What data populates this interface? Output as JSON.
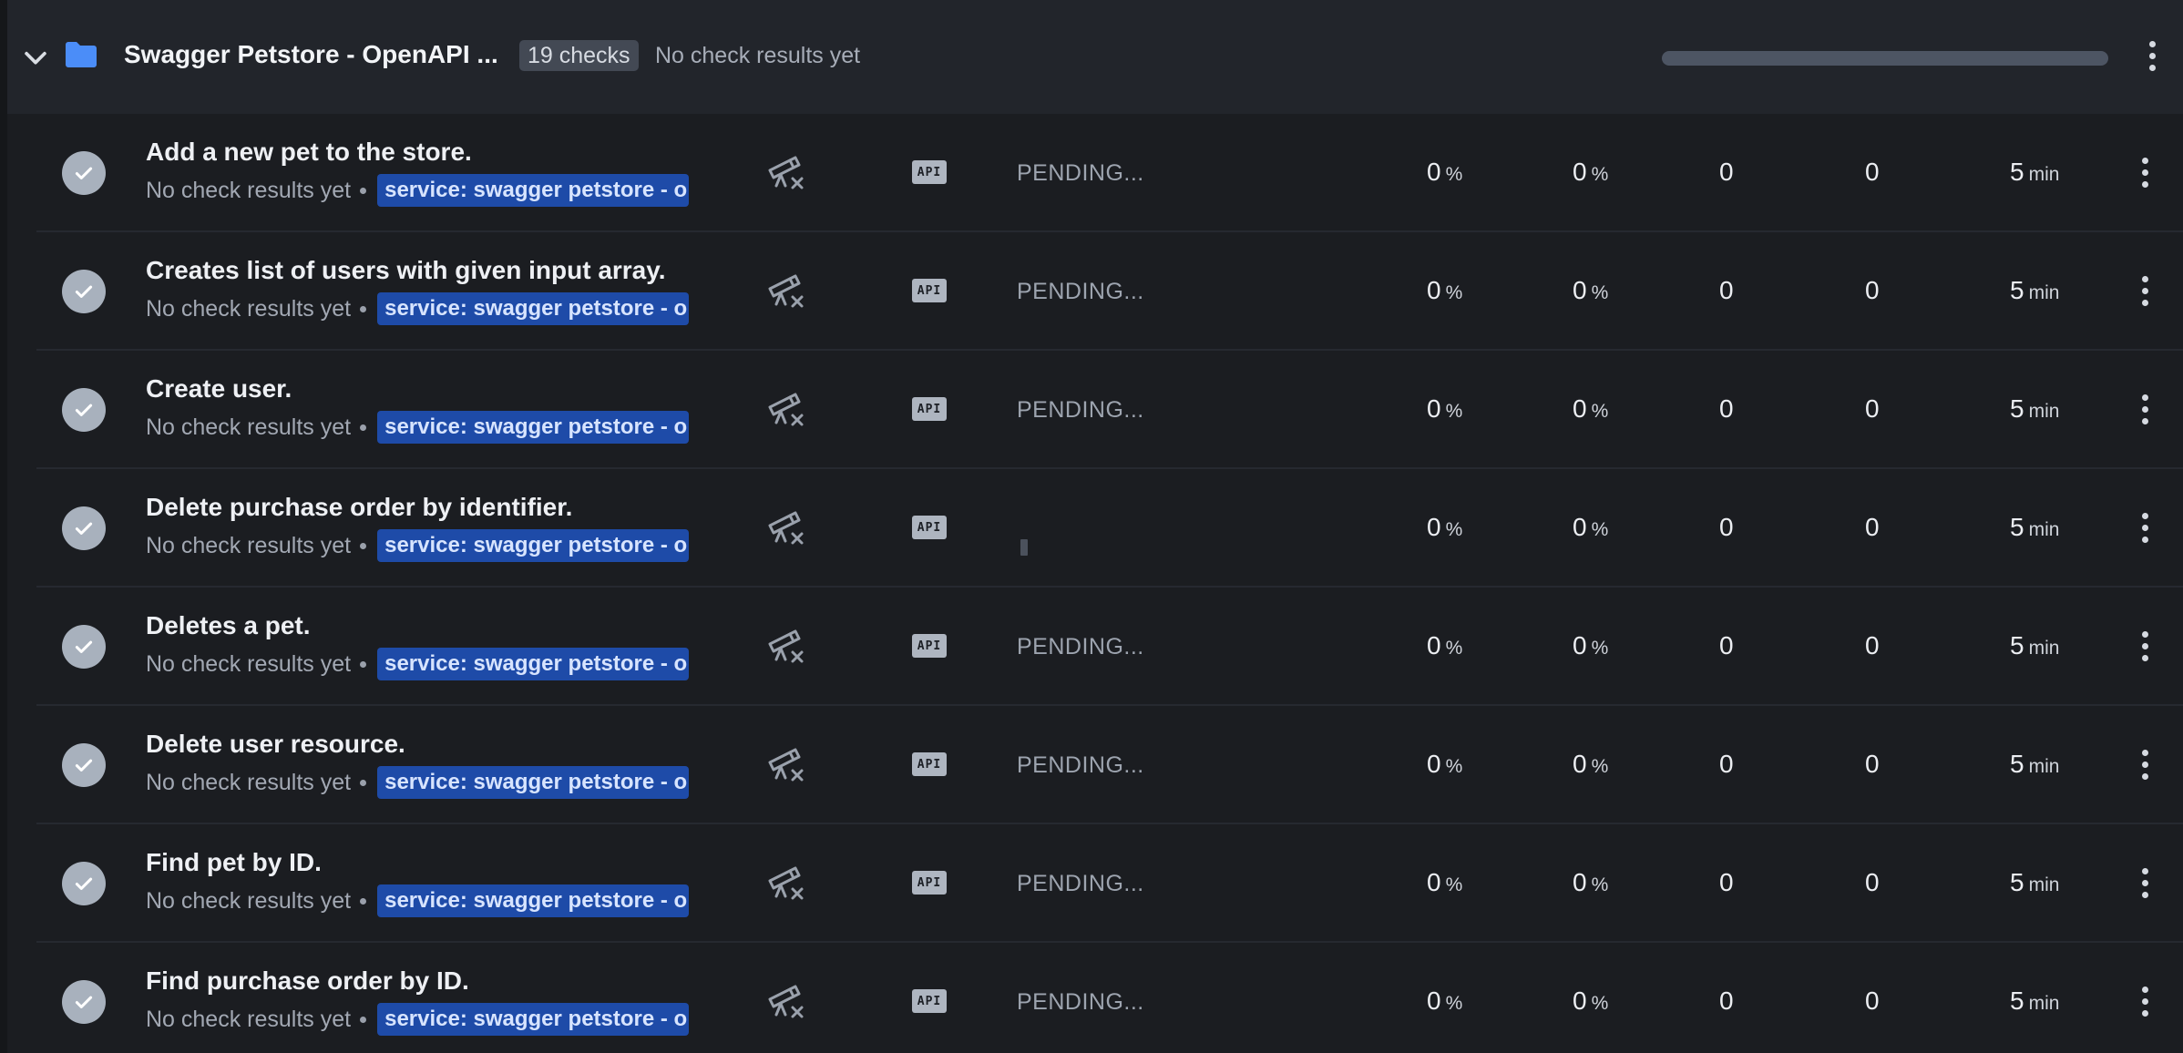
{
  "group": {
    "title": "Swagger Petstore - OpenAPI ...",
    "count_badge": "19 checks",
    "status": "No check results yet",
    "progress": 0,
    "icons": {
      "toggle": "chevron-down-icon",
      "folder": "folder-icon",
      "menu": "more-vertical-icon"
    }
  },
  "colors": {
    "accent_blue": "#1e4ba8",
    "folder_blue": "#4b8df8",
    "tag_text": "#d7e4ff"
  },
  "checks": [
    {
      "title": "Add a new pet to the store.",
      "subtitle": "No check results yet",
      "tag": "service: swagger petstore - o",
      "type": "API",
      "state": "PENDING...",
      "success_24h": "0",
      "success_7d": "0",
      "avg": "0",
      "p95": "0",
      "frequency": "5",
      "pct_unit": "%",
      "freq_unit": "min"
    },
    {
      "title": "Creates list of users with given input array.",
      "subtitle": "No check results yet",
      "tag": "service: swagger petstore - o",
      "type": "API",
      "state": "PENDING...",
      "success_24h": "0",
      "success_7d": "0",
      "avg": "0",
      "p95": "0",
      "frequency": "5",
      "pct_unit": "%",
      "freq_unit": "min"
    },
    {
      "title": "Create user.",
      "subtitle": "No check results yet",
      "tag": "service: swagger petstore - o",
      "type": "API",
      "state": "PENDING...",
      "success_24h": "0",
      "success_7d": "0",
      "avg": "0",
      "p95": "0",
      "frequency": "5",
      "pct_unit": "%",
      "freq_unit": "min"
    },
    {
      "title": "Delete purchase order by identifier.",
      "subtitle": "No check results yet",
      "tag": "service: swagger petstore - o",
      "type": "API",
      "state": "",
      "success_24h": "0",
      "success_7d": "0",
      "avg": "0",
      "p95": "0",
      "frequency": "5",
      "pct_unit": "%",
      "freq_unit": "min"
    },
    {
      "title": "Deletes a pet.",
      "subtitle": "No check results yet",
      "tag": "service: swagger petstore - o",
      "type": "API",
      "state": "PENDING...",
      "success_24h": "0",
      "success_7d": "0",
      "avg": "0",
      "p95": "0",
      "frequency": "5",
      "pct_unit": "%",
      "freq_unit": "min"
    },
    {
      "title": "Delete user resource.",
      "subtitle": "No check results yet",
      "tag": "service: swagger petstore - o",
      "type": "API",
      "state": "PENDING...",
      "success_24h": "0",
      "success_7d": "0",
      "avg": "0",
      "p95": "0",
      "frequency": "5",
      "pct_unit": "%",
      "freq_unit": "min"
    },
    {
      "title": "Find pet by ID.",
      "subtitle": "No check results yet",
      "tag": "service: swagger petstore - o",
      "type": "API",
      "state": "PENDING...",
      "success_24h": "0",
      "success_7d": "0",
      "avg": "0",
      "p95": "0",
      "frequency": "5",
      "pct_unit": "%",
      "freq_unit": "min"
    },
    {
      "title": "Find purchase order by ID.",
      "subtitle": "No check results yet",
      "tag": "service: swagger petstore - o",
      "type": "API",
      "state": "PENDING...",
      "success_24h": "0",
      "success_7d": "0",
      "avg": "0",
      "p95": "0",
      "frequency": "5",
      "pct_unit": "%",
      "freq_unit": "min"
    }
  ],
  "row_icons": {
    "status": "check-circle-icon",
    "monitor": "telescope-off-icon",
    "menu": "more-vertical-icon"
  }
}
